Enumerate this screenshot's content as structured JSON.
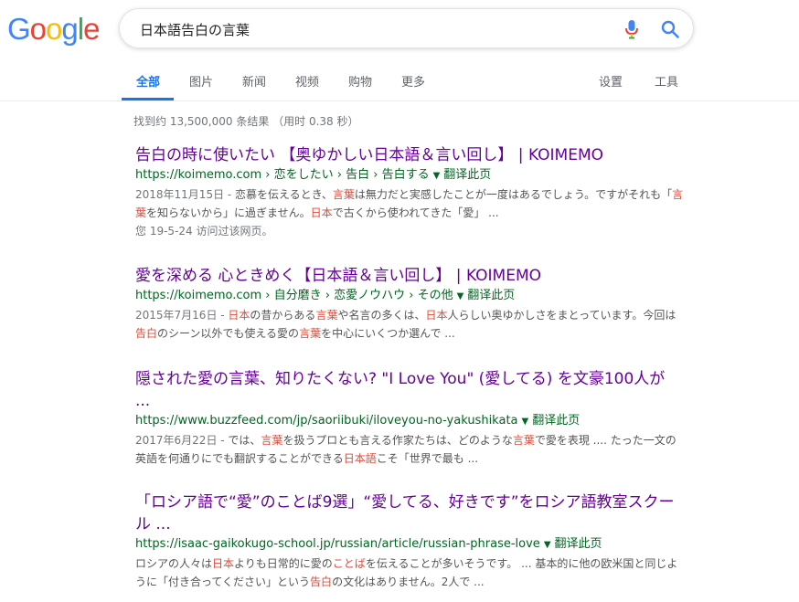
{
  "logo": {
    "letters": [
      "G",
      "o",
      "o",
      "g",
      "l",
      "e"
    ],
    "colors": [
      "#4285F4",
      "#EA4335",
      "#FBBC05",
      "#4285F4",
      "#34A853",
      "#EA4335"
    ]
  },
  "search": {
    "query": "日本語告白の言葉"
  },
  "tabs": {
    "all": "全部",
    "images": "图片",
    "news": "新闻",
    "videos": "视频",
    "shopping": "购物",
    "more": "更多",
    "settings": "设置",
    "tools": "工具"
  },
  "stats": "找到约 13,500,000 条结果 （用时 0.38 秒）",
  "results": [
    {
      "title": "告白の時に使いたい 【奥ゆかしい日本語＆言い回し】 | KOIMEMO",
      "url": "https://koimemo.com › 恋をしたい › 告白 › 告白する",
      "translate": "翻译此页",
      "snippet": [
        {
          "t": "2018年11月15日 - ",
          "c": "date"
        },
        {
          "t": "恋慕を伝えるとき、"
        },
        {
          "t": "言葉",
          "c": "hl"
        },
        {
          "t": "は無力だと実感したことが一度はあるでしょう。ですがそれも「"
        },
        {
          "t": "言葉",
          "c": "hl"
        },
        {
          "t": "を知らないから」に過ぎません。"
        },
        {
          "t": "日本",
          "c": "hl"
        },
        {
          "t": "で古くから使われてきた「愛」 ..."
        }
      ],
      "visited": "您 19-5-24 访问过该网页。"
    },
    {
      "title": "愛を深める 心ときめく【日本語＆言い回し】 | KOIMEMO",
      "url": "https://koimemo.com › 自分磨き › 恋愛ノウハウ › その他",
      "translate": "翻译此页",
      "snippet": [
        {
          "t": "2015年7月16日 - ",
          "c": "date"
        },
        {
          "t": "日本",
          "c": "hl"
        },
        {
          "t": "の昔からある"
        },
        {
          "t": "言葉",
          "c": "hl"
        },
        {
          "t": "や名言の多くは、"
        },
        {
          "t": "日本",
          "c": "hl"
        },
        {
          "t": "人らしい奥ゆかしさをまとっています。今回は"
        },
        {
          "t": "告白",
          "c": "hl"
        },
        {
          "t": "のシーン以外でも使える愛の"
        },
        {
          "t": "言葉",
          "c": "hl"
        },
        {
          "t": "を中心にいくつか選んで ..."
        }
      ]
    },
    {
      "title": "隠された愛の言葉、知りたくない? \"I Love You\" (愛してる) を文豪100人が ...",
      "url": "https://www.buzzfeed.com/jp/saoriibuki/iloveyou-no-yakushikata",
      "translate": "翻译此页",
      "snippet": [
        {
          "t": "2017年6月22日 - ",
          "c": "date"
        },
        {
          "t": "では、"
        },
        {
          "t": "言葉",
          "c": "hl"
        },
        {
          "t": "を扱うプロとも言える作家たちは、どのような"
        },
        {
          "t": "言葉",
          "c": "hl"
        },
        {
          "t": "で愛を表現 .... たった一文の英語を何通りにでも翻訳することができる"
        },
        {
          "t": "日本語",
          "c": "hl"
        },
        {
          "t": "こそ「世界で最も ..."
        }
      ]
    },
    {
      "title": "「ロシア語で“愛”のことば9選」“愛してる、好きです”をロシア語教室スクール ...",
      "url": "https://isaac-gaikokugo-school.jp/russian/article/russian-phrase-love",
      "translate": "翻译此页",
      "snippet": [
        {
          "t": "ロシアの人々は"
        },
        {
          "t": "日本",
          "c": "hl"
        },
        {
          "t": "よりも日常的に愛の"
        },
        {
          "t": "ことば",
          "c": "hl"
        },
        {
          "t": "を伝えることが多いそうです。 ... 基本的に他の欧米国と同じように「付き合ってください」という"
        },
        {
          "t": "告白",
          "c": "hl"
        },
        {
          "t": "の文化はありません。2人で ..."
        }
      ]
    }
  ]
}
